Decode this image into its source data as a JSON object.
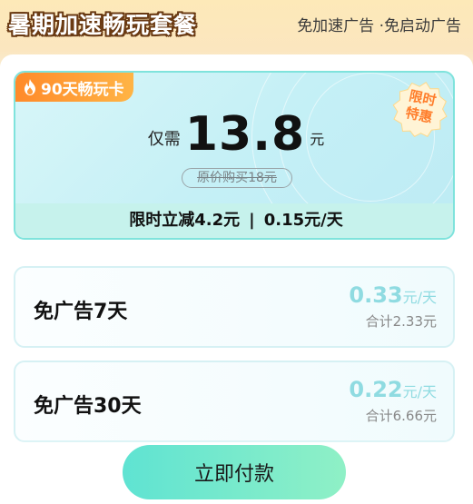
{
  "header": {
    "title": "暑期加速畅玩套餐",
    "benefits": "免加速广告 ·免启动广告"
  },
  "featured": {
    "tag_icon": "flame-icon",
    "tag": "90天畅玩卡",
    "limited_badge": [
      "限时",
      "特惠"
    ],
    "price_prefix": "仅需",
    "price": "13.8",
    "price_unit": "元",
    "original_price": "原价购买18元",
    "discount": "限时立减4.2元",
    "separator": "|",
    "per_day": "0.15元/天"
  },
  "plans": [
    {
      "name": "免广告7天",
      "daily": "0.33",
      "daily_unit": "元/天",
      "total": "合计2.33元"
    },
    {
      "name": "免广告30天",
      "daily": "0.22",
      "daily_unit": "元/天",
      "total": "合计6.66元"
    }
  ],
  "actions": {
    "pay_label": "立即付款"
  },
  "colors": {
    "accent_teal": "#8fdbe1",
    "tag_orange": "#ff8a2a",
    "pay_button": "#5fe3d2"
  }
}
